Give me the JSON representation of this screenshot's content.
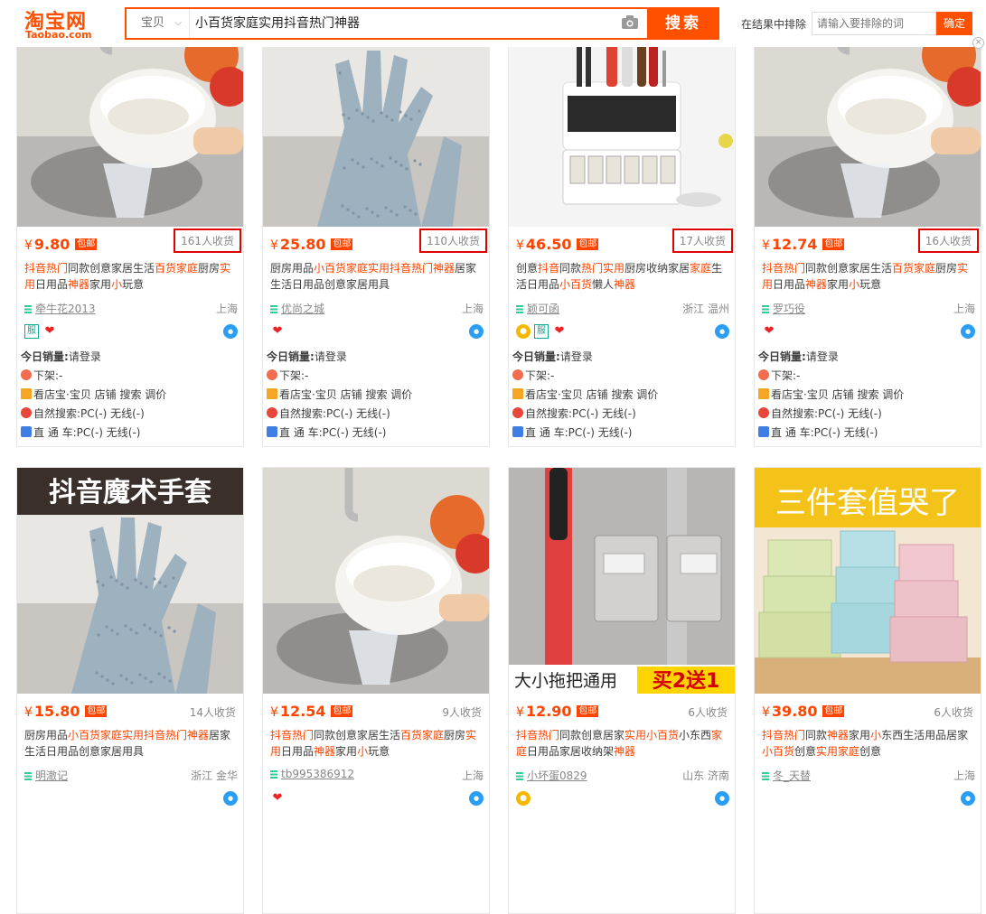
{
  "header": {
    "logo_cn": "淘宝网",
    "logo_en": "Taobao.com",
    "search_scope": "宝贝",
    "search_query": "小百货家庭实用抖音热门神器",
    "search_button": "搜索",
    "exclude_label": "在结果中排除",
    "exclude_placeholder": "请输入要排除的词",
    "confirm_button": "确定",
    "close_symbol": "×"
  },
  "colors": {
    "accent": "#ff5000",
    "price": "#ff4400",
    "highlight_box": "#e00000"
  },
  "labels": {
    "today_sales": "今日销量:",
    "login": "请登录",
    "delist": "下架:-",
    "tools": "看店宝·宝贝 店铺 搜索 调价",
    "organic": "自然搜索:PC(-) 无线(-)",
    "direct": "直 通  车:PC(-) 无线(-)",
    "wangwang_icon": "wangwang-chat-icon"
  },
  "products": [
    {
      "image": "rice-washing-bowl",
      "price": "9.80",
      "free_ship": "包邮",
      "sold": "161人收货",
      "sold_highlighted": true,
      "title_parts": [
        [
          "抖音热门",
          1
        ],
        [
          "同款创意家居生活",
          0
        ],
        [
          "百货家庭",
          1
        ],
        [
          "厨房",
          0
        ],
        [
          "实用",
          1
        ],
        [
          "日用品",
          0
        ],
        [
          "神器",
          1
        ],
        [
          "家用",
          0
        ],
        [
          "小",
          1
        ],
        [
          "玩意",
          0
        ]
      ],
      "shop": "牵牛花2013",
      "location": "上海",
      "badges": [
        "服",
        "heart"
      ],
      "extended": true
    },
    {
      "image": "silicone-gloves",
      "price": "25.80",
      "free_ship": "包邮",
      "sold": "110人收货",
      "sold_highlighted": true,
      "title_parts": [
        [
          "厨房用品",
          0
        ],
        [
          "小百货家庭实用抖音热门神器",
          1
        ],
        [
          "居家生活日用品创意家居用具",
          0
        ]
      ],
      "shop": "优尚之城",
      "location": "上海",
      "badges": [
        "heart"
      ],
      "extended": true
    },
    {
      "image": "knife-rack",
      "price": "46.50",
      "free_ship": "包邮",
      "sold": "17人收货",
      "sold_highlighted": true,
      "title_parts": [
        [
          "创意",
          0
        ],
        [
          "抖音",
          1
        ],
        [
          "同款",
          0
        ],
        [
          "热门实用",
          1
        ],
        [
          "厨房收纳家居",
          0
        ],
        [
          "家庭",
          1
        ],
        [
          "生活日用品",
          0
        ],
        [
          "小百货",
          1
        ],
        [
          "懒人",
          0
        ],
        [
          "神器",
          1
        ]
      ],
      "shop": "颖可函",
      "location": "浙江 温州",
      "badges": [
        "coin",
        "服",
        "heart"
      ],
      "extended": true
    },
    {
      "image": "rice-washing-bowl",
      "price": "12.74",
      "free_ship": "包邮",
      "sold": "16人收货",
      "sold_highlighted": true,
      "title_parts": [
        [
          "抖音热门",
          1
        ],
        [
          "同款创意家居生活",
          0
        ],
        [
          "百货家庭",
          1
        ],
        [
          "厨房",
          0
        ],
        [
          "实用",
          1
        ],
        [
          "日用品",
          0
        ],
        [
          "神器",
          1
        ],
        [
          "家用",
          0
        ],
        [
          "小",
          1
        ],
        [
          "玩意",
          0
        ]
      ],
      "shop": "罗巧役",
      "location": "上海",
      "badges": [
        "heart"
      ],
      "extended": true
    },
    {
      "image": "magic-gloves",
      "image_text": "抖音魔术手套",
      "price": "15.80",
      "free_ship": "包邮",
      "sold": "14人收货",
      "sold_highlighted": false,
      "title_parts": [
        [
          "厨房用品",
          0
        ],
        [
          "小百货家庭实用抖音热门神器",
          1
        ],
        [
          "居家生活日用品创意家居用具",
          0
        ]
      ],
      "shop": "明澈记",
      "location": "浙江 金华",
      "badges": [],
      "extended": false
    },
    {
      "image": "rice-washing-bowl",
      "price": "12.54",
      "free_ship": "包邮",
      "sold": "9人收货",
      "sold_highlighted": false,
      "title_parts": [
        [
          "抖音热门",
          1
        ],
        [
          "同款创意家居生活",
          0
        ],
        [
          "百货家庭",
          1
        ],
        [
          "厨房",
          0
        ],
        [
          "实用",
          1
        ],
        [
          "日用品",
          0
        ],
        [
          "神器",
          1
        ],
        [
          "家用",
          0
        ],
        [
          "小",
          1
        ],
        [
          "玩意",
          0
        ]
      ],
      "shop": "tb995386912",
      "location": "上海",
      "badges": [
        "heart"
      ],
      "extended": false
    },
    {
      "image": "mop-holder",
      "image_text_left": "大小拖把通用",
      "image_text_right": "买2送1",
      "price": "12.90",
      "free_ship": "包邮",
      "sold": "6人收货",
      "sold_highlighted": false,
      "title_parts": [
        [
          "抖音热门",
          1
        ],
        [
          "同款创意居家",
          0
        ],
        [
          "实用小百货",
          1
        ],
        [
          "小东西",
          0
        ],
        [
          "家庭",
          1
        ],
        [
          "日用品家居收纳架",
          0
        ],
        [
          "神器",
          1
        ]
      ],
      "shop": "小坏蛋0829",
      "location": "山东 济南",
      "badges": [
        "coin"
      ],
      "extended": false
    },
    {
      "image": "storage-boxes",
      "image_text": "三件套值哭了",
      "price": "39.80",
      "free_ship": "包邮",
      "sold": "6人收货",
      "sold_highlighted": false,
      "title_parts": [
        [
          "抖音热门",
          1
        ],
        [
          "同款",
          0
        ],
        [
          "神器",
          1
        ],
        [
          "家用",
          0
        ],
        [
          "小",
          1
        ],
        [
          "东西生活用品居家",
          0
        ],
        [
          "小百货",
          1
        ],
        [
          "创意",
          0
        ],
        [
          "实用家庭",
          1
        ],
        [
          "创意",
          0
        ]
      ],
      "shop": "冬_天替",
      "location": "上海",
      "badges": [],
      "extended": false
    }
  ]
}
